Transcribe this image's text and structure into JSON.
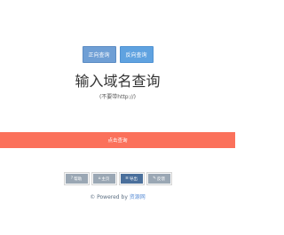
{
  "modes": {
    "tab1": "正向查询",
    "tab2": "反向查询"
  },
  "header": {
    "title": "输入域名查询",
    "subtitle": "(不要带http://)"
  },
  "search": {
    "button_label": "点击查询"
  },
  "tools": {
    "items": [
      {
        "label": "帮助",
        "icon": "?"
      },
      {
        "label": "主页",
        "icon": "⌂"
      },
      {
        "label": "导出",
        "icon": "≡"
      },
      {
        "label": "反馈",
        "icon": "✎"
      }
    ]
  },
  "footer": {
    "prefix": "© Powered by ",
    "brand": "资源网"
  },
  "colors": {
    "accent_red": "#fb715b",
    "tab_blue": "#5fa2e0",
    "primary_dark": "#4a6f9b"
  }
}
